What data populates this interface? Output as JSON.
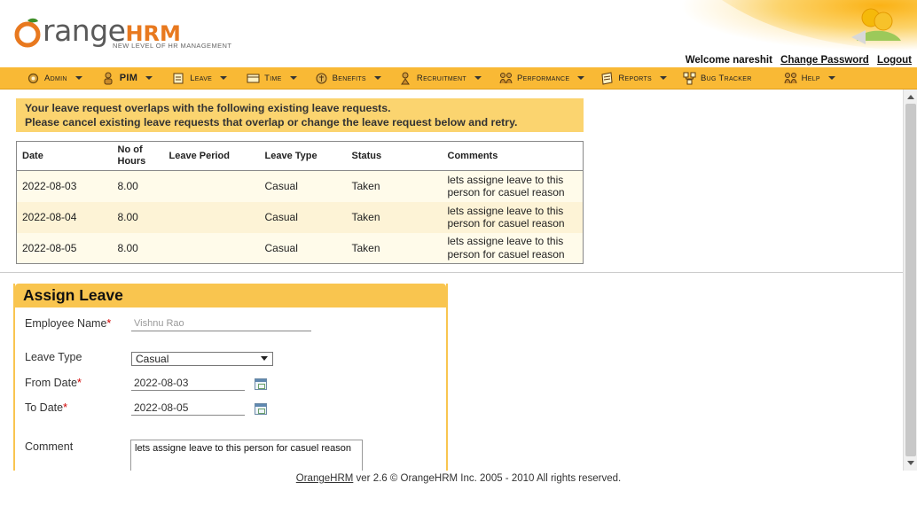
{
  "brand": {
    "logo_main": "range",
    "logo_hrm": "HRM",
    "tagline": "NEW LEVEL OF HR MANAGEMENT",
    "accent": "#f9b935"
  },
  "user_bar": {
    "welcome": "Welcome nareshit",
    "change_password": "Change Password",
    "logout": "Logout"
  },
  "menu": [
    {
      "label": "Admin",
      "icon": "admin-icon"
    },
    {
      "label": "PIM",
      "icon": "pim-icon"
    },
    {
      "label": "Leave",
      "icon": "leave-icon"
    },
    {
      "label": "Time",
      "icon": "time-icon"
    },
    {
      "label": "Benefits",
      "icon": "benefits-icon"
    },
    {
      "label": "Recruitment",
      "icon": "recruitment-icon"
    },
    {
      "label": "Performance",
      "icon": "performance-icon"
    },
    {
      "label": "Reports",
      "icon": "reports-icon"
    },
    {
      "label": "Bug Tracker",
      "icon": "bug-tracker-icon"
    },
    {
      "label": "Help",
      "icon": "help-icon"
    }
  ],
  "warning": {
    "line1": "Your leave request overlaps with the following existing leave requests.",
    "line2": "Please cancel existing leave requests that overlap or change the leave request below and retry."
  },
  "overlap_table": {
    "headers": {
      "date": "Date",
      "hours_line1": "No of",
      "hours_line2": "Hours",
      "period": "Leave Period",
      "type": "Leave Type",
      "status": "Status",
      "comments": "Comments"
    },
    "rows": [
      {
        "date": "2022-08-03",
        "hours": "8.00",
        "period": "",
        "type": "Casual",
        "status": "Taken",
        "comment_line1": "lets assigne leave to this",
        "comment_line2": "person for casuel reason"
      },
      {
        "date": "2022-08-04",
        "hours": "8.00",
        "period": "",
        "type": "Casual",
        "status": "Taken",
        "comment_line1": "lets assigne leave to this",
        "comment_line2": "person for casuel reason"
      },
      {
        "date": "2022-08-05",
        "hours": "8.00",
        "period": "",
        "type": "Casual",
        "status": "Taken",
        "comment_line1": "lets assigne leave to this",
        "comment_line2": "person for casuel reason"
      }
    ]
  },
  "assign_leave": {
    "title": "Assign Leave",
    "employee_label": "Employee Name",
    "employee_value": "Vishnu Rao",
    "leave_type_label": "Leave Type",
    "leave_type_value": "Casual",
    "from_label": "From Date",
    "from_value": "2022-08-03",
    "to_label": "To Date",
    "to_value": "2022-08-05",
    "comment_label": "Comment",
    "comment_value": "lets assigne leave to this person for casuel reason",
    "required_mark": "*"
  },
  "footer": {
    "link": "OrangeHRM",
    "text": " ver 2.6 © OrangeHRM Inc. 2005 - 2010 All rights reserved."
  }
}
